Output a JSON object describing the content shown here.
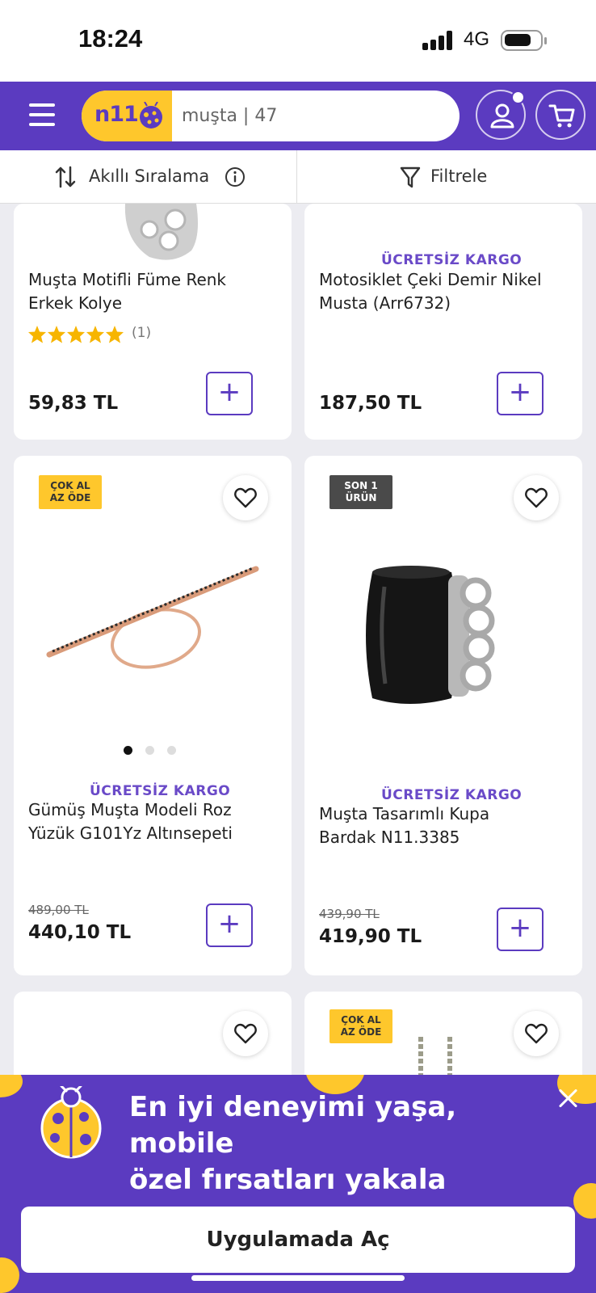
{
  "status_bar": {
    "time": "18:24",
    "network": "4G"
  },
  "header": {
    "logo_text": "n11",
    "search_value": "muşta | 47",
    "brand_color": "#5b3bc0",
    "accent_color": "#fec72c"
  },
  "toolbar": {
    "sort_label": "Akıllı Sıralama",
    "filter_label": "Filtrele"
  },
  "products": [
    {
      "name_line1": "Muşta Motifli Füme Renk",
      "name_line2": "Erkek Kolye",
      "rating_count": "(1)",
      "rating_stars": 5,
      "price": "59,83 TL"
    },
    {
      "cargo": "ÜCRETSİZ KARGO",
      "name_line1": "Motosiklet Çeki Demir Nikel",
      "name_line2": "Musta (Arr6732)",
      "price": "187,50 TL"
    },
    {
      "badge_line1": "ÇOK AL",
      "badge_line2": "AZ ÖDE",
      "cargo": "ÜCRETSİZ KARGO",
      "name_line1": "Gümüş Muşta Modeli Roz",
      "name_line2": "Yüzük G101Yz Altınsepeti",
      "old_price": "489,00 TL",
      "price": "440,10 TL"
    },
    {
      "badge_line1": "SON 1",
      "badge_line2": "ÜRÜN",
      "cargo": "ÜCRETSİZ KARGO",
      "name_line1": "Muşta Tasarımlı Kupa",
      "name_line2": "Bardak N11.3385",
      "old_price": "439,90 TL",
      "price": "419,90 TL"
    },
    {},
    {
      "badge_line1": "ÇOK AL",
      "badge_line2": "AZ ÖDE"
    }
  ],
  "add_label": "+",
  "app_banner": {
    "headline_line1": "En iyi deneyimi yaşa, mobile",
    "headline_line2": "özel fırsatları yakala",
    "cta_label": "Uygulamada Aç"
  }
}
